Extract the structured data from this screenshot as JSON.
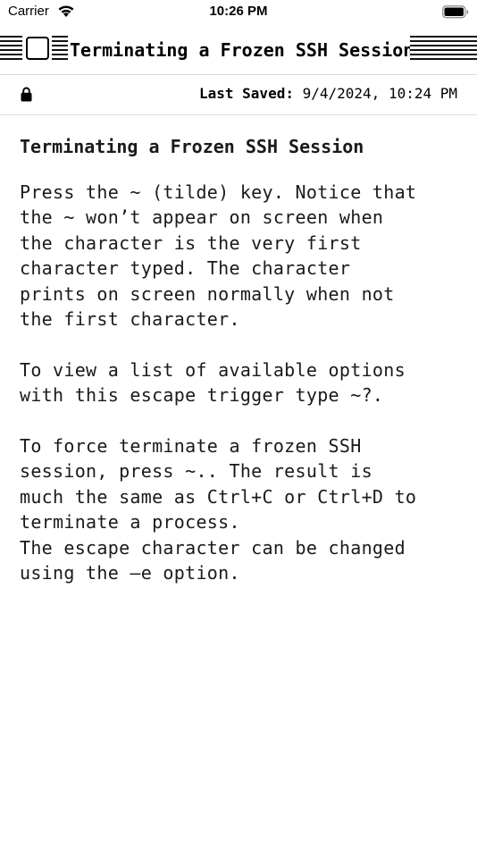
{
  "status_bar": {
    "carrier": "Carrier",
    "time": "10:26 PM"
  },
  "window": {
    "title": "Terminating a Frozen SSH Session"
  },
  "info_bar": {
    "last_saved_label": "Last Saved:",
    "last_saved_value": "9/4/2024, 10:24 PM"
  },
  "document": {
    "title": "Terminating a Frozen SSH Session",
    "body": "Press the ~ (tilde) key. Notice that\nthe ~ won’t appear on screen when\nthe character is the very first\ncharacter typed. The character\nprints on screen normally when not\nthe first character.\n\nTo view a list of available options\nwith this escape trigger type ~?.\n\nTo force terminate a frozen SSH\nsession, press ~.. The result is\nmuch the same as Ctrl+C or Ctrl+D to\nterminate a process.\nThe escape character can be changed\nusing the –e option."
  },
  "icons": {
    "wifi": "wifi-icon",
    "battery": "battery-icon",
    "close": "close-box-icon",
    "lock": "lock-icon"
  }
}
